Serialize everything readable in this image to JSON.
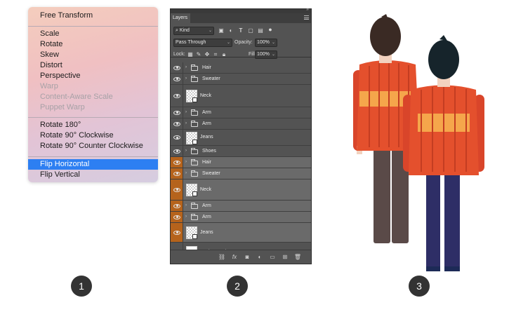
{
  "menu": {
    "items": [
      {
        "label": "Free Transform",
        "state": "normal"
      },
      {
        "label": "Scale",
        "state": "normal"
      },
      {
        "label": "Rotate",
        "state": "normal"
      },
      {
        "label": "Skew",
        "state": "normal"
      },
      {
        "label": "Distort",
        "state": "normal"
      },
      {
        "label": "Perspective",
        "state": "normal"
      },
      {
        "label": "Warp",
        "state": "disabled"
      },
      {
        "label": "Content-Aware Scale",
        "state": "disabled"
      },
      {
        "label": "Puppet Warp",
        "state": "disabled"
      },
      {
        "label": "Rotate 180°",
        "state": "normal"
      },
      {
        "label": "Rotate 90° Clockwise",
        "state": "normal"
      },
      {
        "label": "Rotate 90° Counter Clockwise",
        "state": "normal"
      },
      {
        "label": "Flip Horizontal",
        "state": "selected"
      },
      {
        "label": "Flip Vertical",
        "state": "normal"
      }
    ]
  },
  "layers_panel": {
    "title": "Layers",
    "filter_kind": "Kind",
    "blend_mode": "Pass Through",
    "opacity_label": "Opacity:",
    "opacity_value": "100%",
    "lock_label": "Lock:",
    "fill_label": "Fill:",
    "fill_value": "100%",
    "layers": [
      {
        "name": "Hair",
        "kind": "group",
        "highlighted": false
      },
      {
        "name": "Sweater",
        "kind": "group",
        "highlighted": false
      },
      {
        "name": "Neck",
        "kind": "smart",
        "highlighted": false
      },
      {
        "name": "Arm",
        "kind": "group",
        "highlighted": false
      },
      {
        "name": "Arm",
        "kind": "group",
        "highlighted": false
      },
      {
        "name": "Jeans",
        "kind": "smart",
        "highlighted": false
      },
      {
        "name": "Shoes",
        "kind": "group",
        "highlighted": false
      },
      {
        "name": "Hair",
        "kind": "group",
        "highlighted": true
      },
      {
        "name": "Sweater",
        "kind": "group",
        "highlighted": true
      },
      {
        "name": "Neck",
        "kind": "smart",
        "highlighted": true
      },
      {
        "name": "Arm",
        "kind": "group",
        "highlighted": true
      },
      {
        "name": "Arm",
        "kind": "group",
        "highlighted": true
      },
      {
        "name": "Jeans",
        "kind": "smart",
        "highlighted": true
      },
      {
        "name": "Background",
        "kind": "background",
        "highlighted": false
      }
    ],
    "bottom_icons": [
      "link-icon",
      "fx-icon",
      "mask-icon",
      "adjustment-icon",
      "new-group-icon",
      "new-layer-icon",
      "trash-icon"
    ]
  },
  "steps": [
    "1",
    "2",
    "3"
  ],
  "colors": {
    "menu_highlight": "#2d7ff2",
    "layer_selected_eye": "#b5631c",
    "sweater": "#e4502d",
    "sweater_band": "#f5a64b",
    "hair": "#3a2a24",
    "hair_front": "#16242b",
    "pants_back": "#5a4a48",
    "pants_front": "#2e2e66",
    "skin": "#f2d2bf"
  }
}
